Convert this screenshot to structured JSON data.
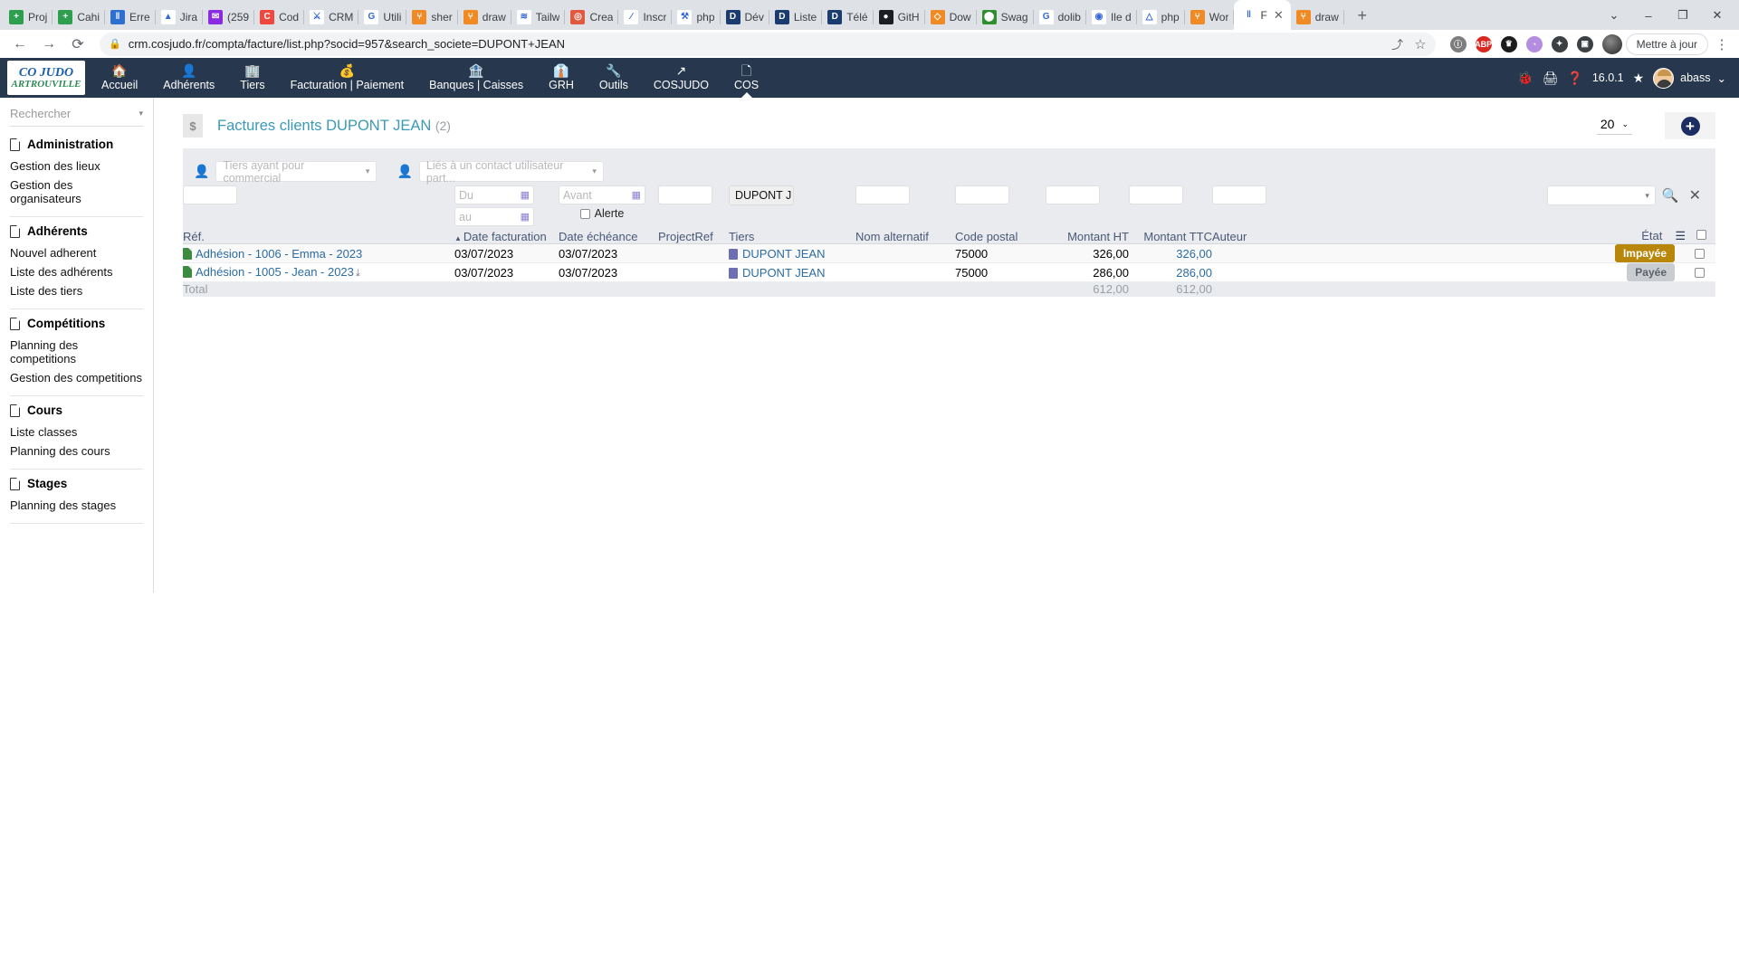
{
  "browser": {
    "tabs": [
      {
        "label": "Proj",
        "icon": "calendar-icon",
        "color": "#2e9e4f",
        "glyph": "+"
      },
      {
        "label": "Cahi",
        "icon": "calendar-icon",
        "color": "#2e9e4f",
        "glyph": "+"
      },
      {
        "label": "Erre",
        "icon": "trello-icon",
        "color": "#2f6fd0",
        "glyph": "‖"
      },
      {
        "label": "Jira",
        "icon": "jira-icon",
        "color": "#ffffff",
        "glyph": "▲"
      },
      {
        "label": "(259",
        "icon": "mail-icon",
        "color": "#8a2be2",
        "glyph": "✉"
      },
      {
        "label": "Cod",
        "icon": "codepen-icon",
        "color": "#f0483e",
        "glyph": "C"
      },
      {
        "label": "CRM",
        "icon": "dolibarr-icon",
        "color": "#ffffff",
        "glyph": "⚔"
      },
      {
        "label": "Utili",
        "icon": "google-icon",
        "color": "#ffffff",
        "glyph": "G"
      },
      {
        "label": "sher",
        "icon": "sitemap-icon",
        "color": "#f08a24",
        "glyph": "⑂"
      },
      {
        "label": "draw",
        "icon": "sitemap-icon",
        "color": "#f08a24",
        "glyph": "⑂"
      },
      {
        "label": "Tailw",
        "icon": "tailwind-icon",
        "color": "#ffffff",
        "glyph": "≋"
      },
      {
        "label": "Crea",
        "icon": "ionic-icon",
        "color": "#e2593f",
        "glyph": "◎"
      },
      {
        "label": "Inscr",
        "icon": "pen-icon",
        "color": "#ffffff",
        "glyph": "∕"
      },
      {
        "label": "php",
        "icon": "phpmyadmin-icon",
        "color": "#ffffff",
        "glyph": "⚒"
      },
      {
        "label": "Dév",
        "icon": "dolibarr-d-icon",
        "color": "#1b3c6e",
        "glyph": "D"
      },
      {
        "label": "Liste",
        "icon": "dolibarr-d-icon",
        "color": "#1b3c6e",
        "glyph": "D"
      },
      {
        "label": "Télé",
        "icon": "dolibarr-d-icon",
        "color": "#1b3c6e",
        "glyph": "D"
      },
      {
        "label": "GitH",
        "icon": "github-icon",
        "color": "#1b1f23",
        "glyph": "●"
      },
      {
        "label": "Dow",
        "icon": "diamond-icon",
        "color": "#f08a24",
        "glyph": "◇"
      },
      {
        "label": "Swag",
        "icon": "swagger-icon",
        "color": "#2f8f2f",
        "glyph": "⬤"
      },
      {
        "label": "dolib",
        "icon": "google-icon",
        "color": "#ffffff",
        "glyph": "G"
      },
      {
        "label": "Ile d",
        "icon": "maps-pin-icon",
        "color": "#ffffff",
        "glyph": "◉"
      },
      {
        "label": "php",
        "icon": "drive-icon",
        "color": "#ffffff",
        "glyph": "△"
      },
      {
        "label": "Wor",
        "icon": "sitemap-icon",
        "color": "#f08a24",
        "glyph": "⑂"
      },
      {
        "label": "F",
        "icon": "dolibarr-favicon",
        "color": "#ffffff",
        "glyph": "‖",
        "active": true
      },
      {
        "label": "draw",
        "icon": "sitemap-icon",
        "color": "#f08a24",
        "glyph": "⑂"
      }
    ],
    "new_tab_label": "+",
    "window_buttons": [
      "⌄",
      "–",
      "❐",
      "✕"
    ],
    "url": "crm.cosjudo.fr/compta/facture/list.php?socid=957&search_societe=DUPONT+JEAN",
    "lock_icon": "🔒",
    "back_icon": "←",
    "forward_icon": "→",
    "reload_icon": "⟳",
    "share_icon": "⤴",
    "bookmark_icon": "☆",
    "extensions": [
      {
        "name": "ghostery-extension",
        "color": "#7d7d7d",
        "glyph": "ⓘ"
      },
      {
        "name": "adblock-plus-extension",
        "color": "#d9281f",
        "glyph": "ABP"
      },
      {
        "name": "honey-extension",
        "color": "#1c1c1c",
        "glyph": "♛"
      },
      {
        "name": "grammarly-extension",
        "color": "#b58de0",
        "glyph": "◔"
      },
      {
        "name": "puzzle-extensions",
        "color": "#3c4043",
        "glyph": "✦"
      },
      {
        "name": "sidepanel-toggle",
        "color": "#3c4043",
        "glyph": "▣"
      }
    ],
    "profile_label": "",
    "update_label": "Mettre à jour",
    "menu_icon": "⋮"
  },
  "app": {
    "logo_line1": "CO JUDO",
    "logo_line2": "ARTROUVILLE",
    "nav": [
      {
        "label": "Accueil",
        "icon": "home-icon",
        "glyph": "🏠"
      },
      {
        "label": "Adhérents",
        "icon": "user-icon",
        "glyph": "👤"
      },
      {
        "label": "Tiers",
        "icon": "building-icon",
        "glyph": "🏢"
      },
      {
        "label": "Facturation | Paiement",
        "icon": "coins-icon",
        "glyph": "💰"
      },
      {
        "label": "Banques | Caisses",
        "icon": "bank-icon",
        "glyph": "🏦"
      },
      {
        "label": "GRH",
        "icon": "employee-icon",
        "glyph": "👔"
      },
      {
        "label": "Outils",
        "icon": "wrench-icon",
        "glyph": "🔧"
      },
      {
        "label": "COSJUDO",
        "icon": "external-link-icon",
        "glyph": "↗"
      },
      {
        "label": "COS",
        "icon": "page-icon",
        "glyph": "🗋",
        "selected": true
      }
    ],
    "topright": {
      "bug_icon": "🐞",
      "print_icon": "🖨",
      "help_icon": "❓",
      "version": "16.0.1",
      "star_icon": "★",
      "user": "abass",
      "user_caret": "⌄"
    }
  },
  "sidebar": {
    "search_placeholder": "Rechercher",
    "search_caret": "▾",
    "groups": [
      {
        "title": "Administration",
        "items": [
          "Gestion des lieux",
          "Gestion des organisateurs"
        ]
      },
      {
        "title": "Adhérents",
        "items": [
          "Nouvel adherent",
          "Liste des adhérents",
          "Liste des tiers"
        ]
      },
      {
        "title": "Compétitions",
        "items": [
          "Planning des competitions",
          "Gestion des competitions"
        ]
      },
      {
        "title": "Cours",
        "items": [
          "Liste classes",
          "Planning des cours"
        ]
      },
      {
        "title": "Stages",
        "items": [
          "Planning des stages"
        ]
      }
    ]
  },
  "main": {
    "title": "Factures clients DUPONT JEAN",
    "count": "(2)",
    "title_icon": "invoice-icon",
    "per_page": "20",
    "per_page_caret": "⌄",
    "add_button_glyph": "+",
    "filters": {
      "commercial_placeholder": "Tiers ayant pour commercial",
      "contact_placeholder": "Liés à un contact utilisateur part...",
      "caret": "▾",
      "date_from_placeholder": "Du",
      "date_to_placeholder": "au",
      "due_before_placeholder": "Avant",
      "alert_label": "Alerte",
      "tiers_value": "DUPONT J",
      "search_icon": "🔍",
      "clear_icon": "✕",
      "calendar_icon": "▦"
    },
    "columns": [
      {
        "key": "ref",
        "label": "Réf.",
        "align": "left"
      },
      {
        "key": "date_facturation",
        "label": "Date facturation",
        "align": "left",
        "sorted": true,
        "sort_arrow": "▲"
      },
      {
        "key": "date_echeance",
        "label": "Date échéance",
        "align": "left"
      },
      {
        "key": "projectref",
        "label": "ProjectRef",
        "align": "left"
      },
      {
        "key": "tiers",
        "label": "Tiers",
        "align": "left"
      },
      {
        "key": "nom_alternatif",
        "label": "Nom alternatif",
        "align": "left"
      },
      {
        "key": "code_postal",
        "label": "Code postal",
        "align": "left"
      },
      {
        "key": "montant_ht",
        "label": "Montant HT",
        "align": "right"
      },
      {
        "key": "montant_ttc",
        "label": "Montant TTC",
        "align": "right"
      },
      {
        "key": "auteur",
        "label": "Auteur",
        "align": "left"
      },
      {
        "key": "etat",
        "label": "État",
        "align": "right"
      }
    ],
    "column_picker_icon": "☰",
    "select_all_icon": "☐",
    "rows": [
      {
        "ref": "Adhésion - 1006 - Emma - 2023",
        "has_download": false,
        "date_facturation": "03/07/2023",
        "date_echeance": "03/07/2023",
        "projectref": "",
        "tiers": "DUPONT JEAN",
        "nom_alternatif": "",
        "code_postal": "75000",
        "montant_ht": "326,00",
        "montant_ttc": "326,00",
        "auteur": "",
        "etat": "Impayée",
        "etat_kind": "unpaid"
      },
      {
        "ref": "Adhésion - 1005 - Jean - 2023",
        "has_download": true,
        "date_facturation": "03/07/2023",
        "date_echeance": "03/07/2023",
        "projectref": "",
        "tiers": "DUPONT JEAN",
        "nom_alternatif": "",
        "code_postal": "75000",
        "montant_ht": "286,00",
        "montant_ttc": "286,00",
        "auteur": "",
        "etat": "Payée",
        "etat_kind": "paid"
      }
    ],
    "total": {
      "label": "Total",
      "montant_ht": "612,00",
      "montant_ttc": "612,00"
    }
  },
  "colors": {
    "nav_bg": "#26374e",
    "accent_link": "#2b6ca3",
    "title": "#3a9ab5",
    "unpaid": "#b8860b",
    "paid": "#c9ccd1",
    "panel_bg": "#e9ebee"
  }
}
